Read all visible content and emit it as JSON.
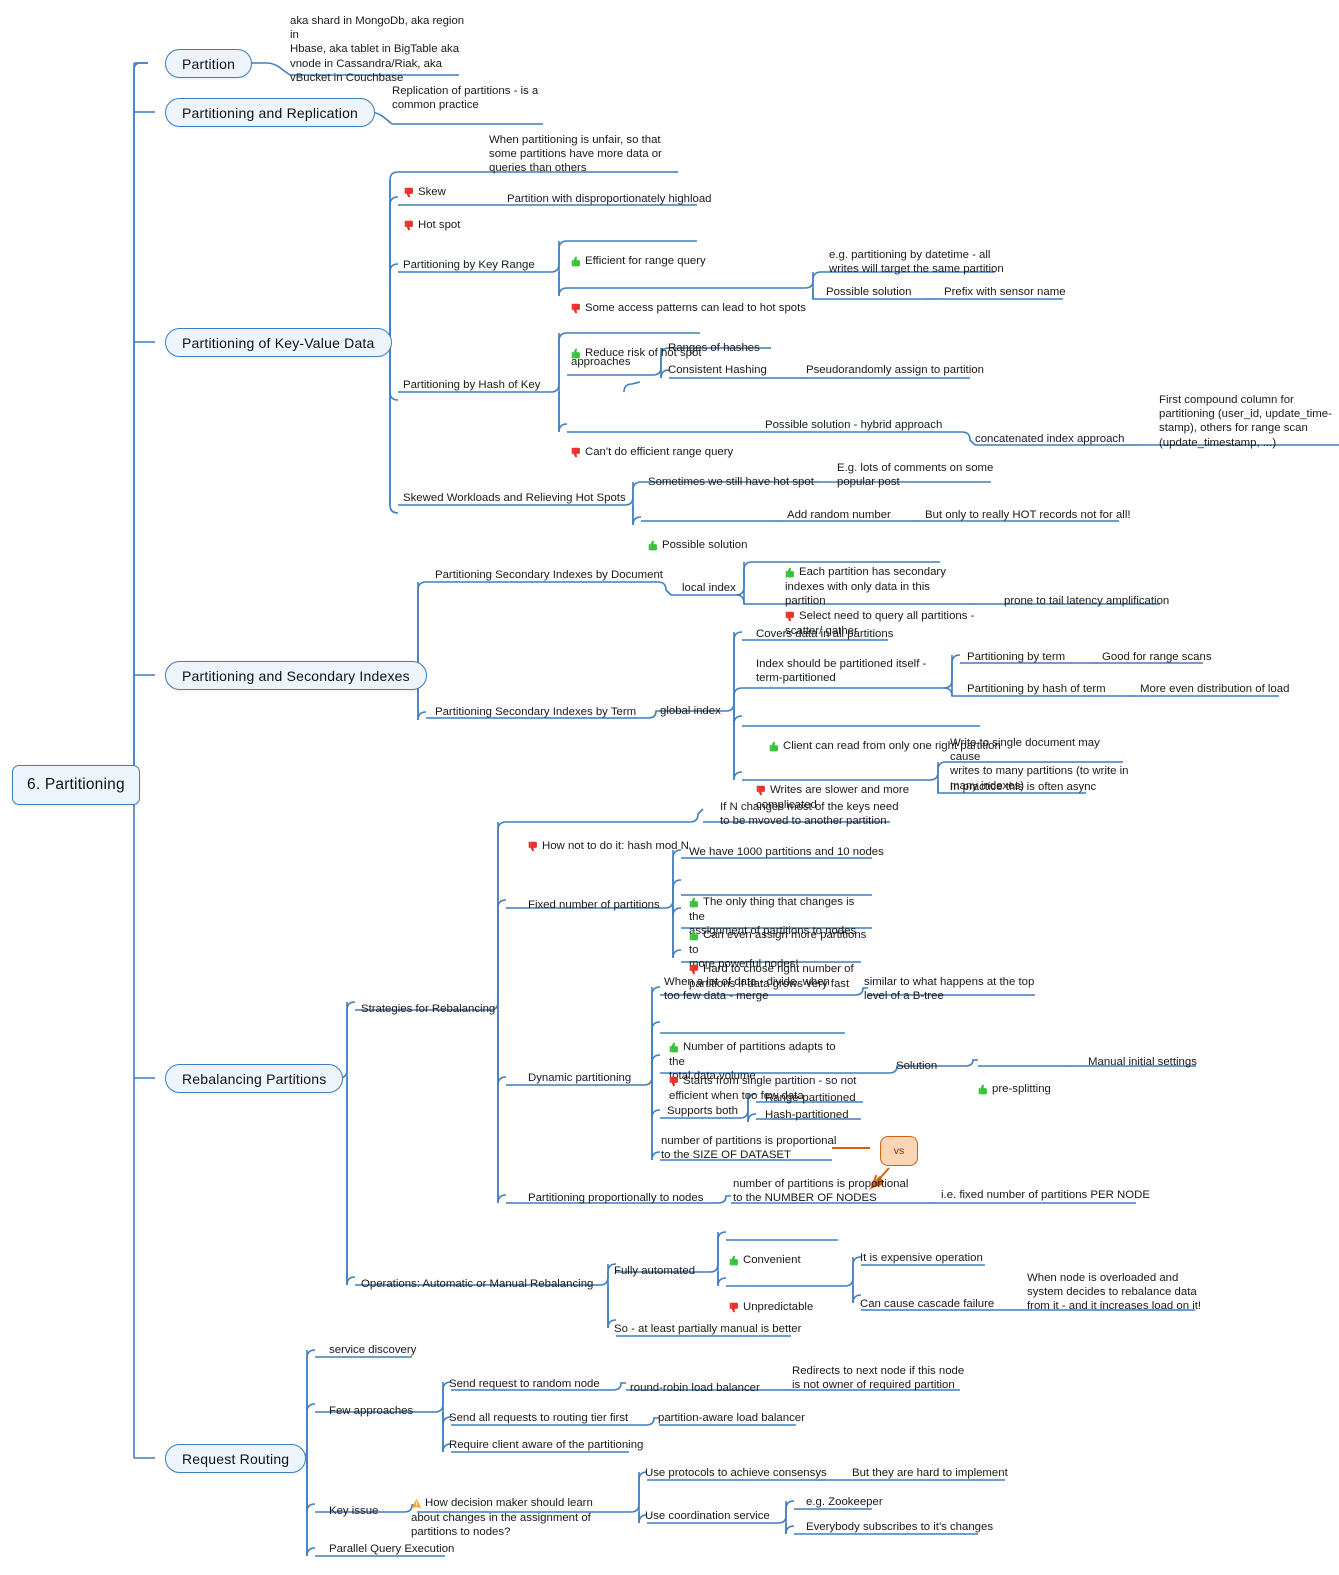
{
  "root": {
    "label": "6. Partitioning"
  },
  "branches": [
    {
      "id": "partition",
      "label": "Partition"
    },
    {
      "id": "partitioning-and-replication",
      "label": "Partitioning and Replication"
    },
    {
      "id": "partitioning-of-key-value-data",
      "label": "Partitioning of Key-Value Data"
    },
    {
      "id": "partitioning-and-secondary-indexes",
      "label": "Partitioning and Secondary Indexes"
    },
    {
      "id": "rebalancing-partitions",
      "label": "Rebalancing Partitions"
    },
    {
      "id": "request-routing",
      "label": "Request Routing"
    }
  ],
  "topics": {
    "t1": "aka shard in MongoDb, aka region in\nHbase, aka tablet in BigTable aka\nvnode in Cassandra/Riak, aka\nvBucket in Couchbase",
    "t2": "Replication of partitions - is a\ncommon practice",
    "t3": "Skew",
    "t4": "When partitioning is unfair, so that\nsome partitions have more data or\nqueries than others",
    "t5": "Hot spot",
    "t6": "Partition with disproportionately highload",
    "t7": "Partitioning by Key Range",
    "t8": "Efficient for range query",
    "t9": "Some access patterns can lead to hot spots",
    "t10": "e.g. partitioning by datetime - all\nwrites will target the same partition",
    "t11": "Possible solution",
    "t12": "Prefix with sensor name",
    "t13": "Partitioning by Hash of Key",
    "t14": "Reduce risk of hot spot",
    "t15": "approaches",
    "t16": "Ranges of hashes",
    "t17": "Consistent Hashing",
    "t18": "Pseudorandomly assign to partition",
    "t19": "Can't do efficient range query",
    "t20": "Possible solution - hybrid approach",
    "t21": "concatenated index approach",
    "t22": "First compound column for\npartitioning (user_id, update_time-\nstamp), others for range scan\n(update_timestamp, ...)",
    "t23": "Skewed Workloads and Relieving Hot Spots",
    "t24": "Sometimes we still have hot spot",
    "t25": "E.g. lots of comments on some\npopular post",
    "t26": "Possible solution",
    "t27": "Add random number",
    "t28": "But only to really HOT records not for all!",
    "t29": "Partitioning Secondary Indexes by Document",
    "t30": "local index",
    "t31": "Each partition has secondary\nindexes with only data in this\npartition",
    "t32": "Select need to query all partitions -\nscatter/ gather",
    "t33": "prone to tail latency amplification",
    "t34": "Partitioning Secondary Indexes by Term",
    "t35": "global index",
    "t36": "Covers data in all partitions",
    "t37": "Index should be partitioned itself -\nterm-partitioned",
    "t38": "Partitioning by term",
    "t39": "Good for range scans",
    "t40": "Partitioning by hash of term",
    "t41": "More even distribution of load",
    "t42": "Client can read from only one right partition",
    "t43": "Writes are slower and more\ncomplicated",
    "t44": "Write to single document may cause\nwrites to many partitions (to write in\nmany indexes)",
    "t45": "In practice this is often async",
    "t46": "Strategies for Rebalancing",
    "t47": "How not to do it: hash mod N",
    "t48": "If N changes most of the keys need\nto be mvoved to another partition",
    "t49": "Fixed number of partitions",
    "t50": "We have 1000 partitions and 10 nodes",
    "t51": "The only thing that changes is the\nassignment of partitions to nodes",
    "t52": "Can even assign more partitions to\nmore powerful nodes!",
    "t53": "Hard to chose right number of\npartitions if data grows very fast",
    "t54": "Dynamic partitioning",
    "t55": "When a lot of data - divide, when\ntoo few data - merge",
    "t56": "similar to what happens at the top\nlevel of a B-tree",
    "t57": "Number of partitions adapts to the\ntotal data volume",
    "t58": "Starts from single partition - so not\nefficient when too few data",
    "t59": "Solution",
    "t60": "pre-splitting",
    "t61": "Manual initial settings",
    "t62": "Supports both",
    "t63": "Range-partitioned",
    "t64": "Hash-partitioned",
    "t65": "number of partitions is proportional\nto the SIZE OF DATASET",
    "t66": "vs",
    "t67": "Partitioning proportionally to nodes",
    "t68": "number of partitions is proportional\nto the NUMBER OF NODES",
    "t69": "i.e. fixed number of partitions PER NODE",
    "t70": "Operations: Automatic or Manual Rebalancing",
    "t71": "Fully automated",
    "t72": "Convenient",
    "t73": "Unpredictable",
    "t74": "It is expensive operation",
    "t75": "Can cause cascade failure",
    "t76": "When node is overloaded and\nsystem decides to rebalance data\nfrom it - and it increases load on it!",
    "t77": "So - at least partially manual is better",
    "t78": "service discovery",
    "t79": "Few approaches",
    "t80": "Send request to random node",
    "t81": "round-robin load balancer",
    "t82": "Redirects to next node if this node\nis not owner of required partition",
    "t83": "Send all requests to routing tier first",
    "t84": "partition-aware load balancer",
    "t85": "Require client aware of the partitioning",
    "t86": "Key issue",
    "t87": "How decision maker should learn\nabout changes in the assignment of\npartitions to nodes?",
    "t88": "Use protocols to achieve consensys",
    "t89": "But they are hard to implement",
    "t90": "Use coordination service",
    "t91": "e.g. Zookeeper",
    "t92": "Everybody subscribes to it's changes",
    "t93": "Parallel Query Execution"
  },
  "icons": {
    "thumbs_up": "thumbs-up-icon",
    "thumbs_down": "thumbs-down-icon",
    "warning": "warning-icon"
  },
  "colors": {
    "line": "#3f7fbf",
    "node_fill": "#eef4fb",
    "node_border": "#3f7fbf",
    "thumbs_up": "#3cc13c",
    "thumbs_down": "#e8322a",
    "warning": "#f5a623",
    "vs_fill": "#fbd5b5",
    "vs_border": "#d2600f",
    "text": "#1a1a1a"
  }
}
